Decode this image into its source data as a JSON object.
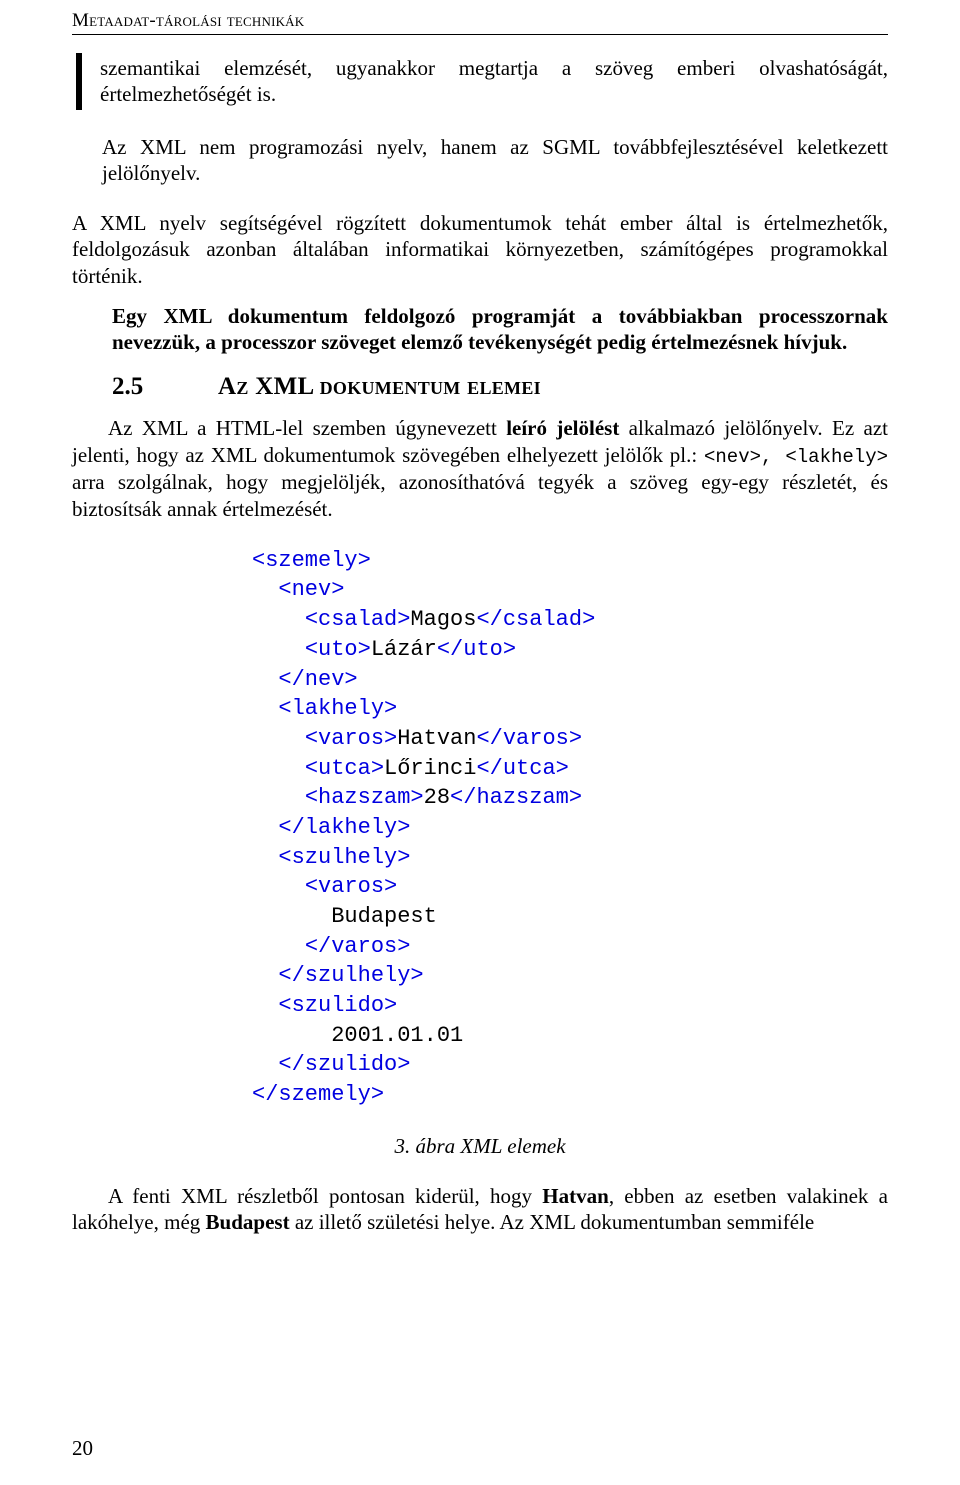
{
  "running_head": "Metaadat-tárolási technikák",
  "bar_block": "szemantikai elemzését, ugyanakkor megtartja a szöveg emberi olvashatóságát, értelmezhetőségét is.",
  "indent_block": "Az XML nem programozási nyelv, hanem az SGML továbbfejlesztésével keletkezett jelölőnyelv.",
  "para1": "A XML nyelv segítségével rögzített dokumentumok tehát ember által is értelmezhetők, feldolgozásuk azonban általában informatikai környezetben, számítógépes programokkal történik.",
  "para_bold": "Egy XML dokumentum feldolgozó programját a továbbiakban processzornak nevezzük, a processzor szöveget elemző tevékenységét pedig értelmezésnek hívjuk.",
  "heading": {
    "num": "2.5",
    "title": "Az XML dokumentum elemei"
  },
  "para2_part1": "Az XML a HTML-lel szemben úgynevezett ",
  "para2_bold1": "leíró jelölést",
  "para2_part2": " alkalmazó jelölőnyelv. Ez azt jelenti, hogy az XML dokumentumok szövegében elhelyezett jelölők pl.: ",
  "para2_mono1": "<nev>",
  "para2_mono_sep": ", ",
  "para2_mono2": "<lakhely>",
  "para2_part3": " arra szolgálnak, hogy megjelöljék, azonosíthatóvá tegyék a szöveg egy-egy részletét, és biztosítsák annak értelmezését.",
  "code": {
    "l01a": "<szemely>",
    "l02a": "<nev>",
    "l03a": "<csalad>",
    "l03t": "Magos",
    "l03b": "</csalad>",
    "l04a": "<uto>",
    "l04t": "Lázár",
    "l04b": "</uto>",
    "l05a": "</nev>",
    "l06a": "<lakhely>",
    "l07a": "<varos>",
    "l07t": "Hatvan",
    "l07b": "</varos>",
    "l08a": "<utca>",
    "l08t": "Lőrinci",
    "l08b": "</utca>",
    "l09a": "<hazszam>",
    "l09t": "28",
    "l09b": "</hazszam>",
    "l10a": "</lakhely>",
    "l11a": "<szulhely>",
    "l12a": "<varos>",
    "l13t": "Budapest",
    "l14a": "</varos>",
    "l15a": "</szulhely>",
    "l16a": "<szulido>",
    "l17t": "2001.01.01",
    "l18a": "</szulido>",
    "l19a": "</szemely>",
    "sp1": "  ",
    "sp2": "    ",
    "sp3": "      "
  },
  "caption": "3. ábra XML elemek",
  "para3_part1": "A fenti XML részletből pontosan kiderül, hogy ",
  "para3_bold1": "Hatvan",
  "para3_part2": ", ebben az esetben valakinek a lakóhelye, még ",
  "para3_bold2": "Budapest",
  "para3_part3": " az illető születési helye. Az XML dokumentumban semmiféle",
  "page_number": "20"
}
